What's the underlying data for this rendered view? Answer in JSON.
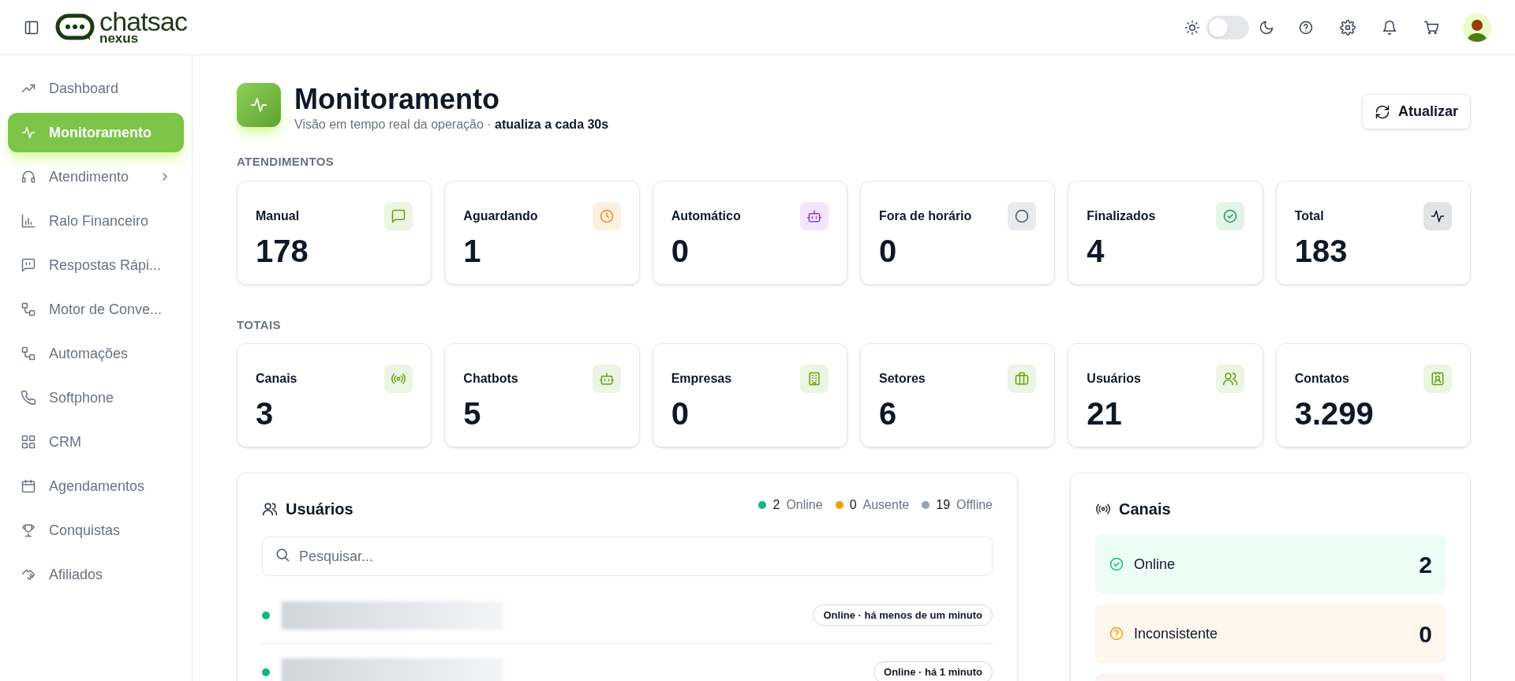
{
  "header": {
    "logo": {
      "word": "chatsac",
      "sub": "nexus"
    },
    "theme_toggle": {
      "on": false
    }
  },
  "sidebar": {
    "items": [
      {
        "label": "Dashboard",
        "selected": false,
        "has_submenu": false
      },
      {
        "label": "Monitoramento",
        "selected": true,
        "has_submenu": false
      },
      {
        "label": "Atendimento",
        "selected": false,
        "has_submenu": true
      },
      {
        "label": "Ralo Financeiro",
        "selected": false,
        "has_submenu": false
      },
      {
        "label": "Respostas Rápi...",
        "selected": false,
        "has_submenu": false
      },
      {
        "label": "Motor de Conve...",
        "selected": false,
        "has_submenu": false
      },
      {
        "label": "Automações",
        "selected": false,
        "has_submenu": false
      },
      {
        "label": "Softphone",
        "selected": false,
        "has_submenu": false
      },
      {
        "label": "CRM",
        "selected": false,
        "has_submenu": false
      },
      {
        "label": "Agendamentos",
        "selected": false,
        "has_submenu": false
      },
      {
        "label": "Conquistas",
        "selected": false,
        "has_submenu": false
      },
      {
        "label": "Afiliados",
        "selected": false,
        "has_submenu": false
      }
    ]
  },
  "page": {
    "title": "Monitoramento",
    "subtitle": "Visão em tempo real da operação · **atualiza a cada 30s**",
    "refresh_button": "Atualizar"
  },
  "sections": [
    {
      "heading": "ATENDIMENTOS",
      "cards": [
        {
          "label": "Manual",
          "value": "178",
          "color": "#65a30d"
        },
        {
          "label": "Aguardando",
          "value": "1",
          "color": "#ea8a0c"
        },
        {
          "label": "Automático",
          "value": "0",
          "color": "#9333ea"
        },
        {
          "label": "Fora de horário",
          "value": "0",
          "color": "#475569"
        },
        {
          "label": "Finalizados",
          "value": "4",
          "color": "#16a34a"
        },
        {
          "label": "Total",
          "value": "183",
          "color": "#111827"
        }
      ]
    },
    {
      "heading": "TOTAIS",
      "cards": [
        {
          "label": "Canais",
          "value": "3",
          "color": "#65a30d"
        },
        {
          "label": "Chatbots",
          "value": "5",
          "color": "#65a30d"
        },
        {
          "label": "Empresas",
          "value": "0",
          "color": "#65a30d"
        },
        {
          "label": "Setores",
          "value": "6",
          "color": "#65a30d"
        },
        {
          "label": "Usuários",
          "value": "21",
          "color": "#65a30d"
        },
        {
          "label": "Contatos",
          "value": "3.299",
          "color": "#65a30d"
        }
      ]
    }
  ],
  "users_panel": {
    "title": "Usuários",
    "legend": [
      {
        "count": "2",
        "label": "Online",
        "color": "#10b981"
      },
      {
        "count": "0",
        "label": "Ausente",
        "color": "#f59e0b"
      },
      {
        "count": "19",
        "label": "Offline",
        "color": "#94a3b8"
      }
    ],
    "search": {
      "placeholder": "Pesquisar..."
    },
    "users": [
      {
        "color": "#10b981",
        "status": "Online · há menos de um minuto"
      },
      {
        "color": "#10b981",
        "status": "Online · há 1 minuto"
      }
    ]
  },
  "channels_panel": {
    "title": "Canais",
    "rows": [
      {
        "kind": "online",
        "label": "Online",
        "value": "2",
        "color": "#ecfdf5"
      },
      {
        "kind": "inconsistent",
        "label": "Inconsistente",
        "value": "0",
        "color": "#fff7ed"
      },
      {
        "kind": "offline",
        "color": "#fef2f2"
      }
    ]
  }
}
